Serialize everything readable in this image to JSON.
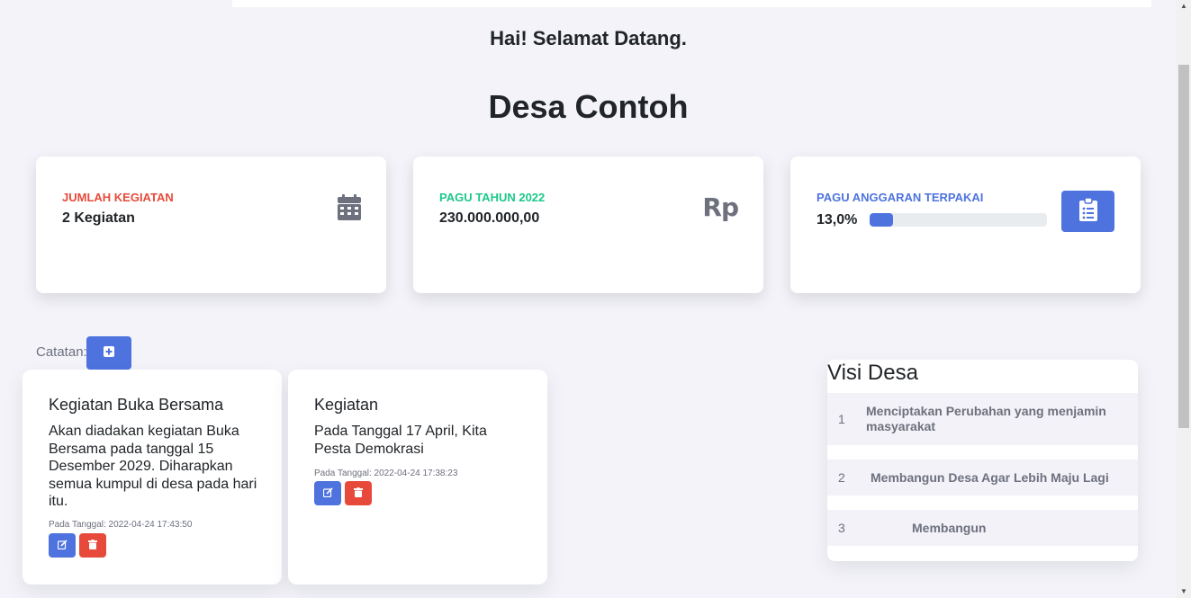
{
  "header": {
    "greeting": "Hai! Selamat Datang.",
    "village_name": "Desa Contoh"
  },
  "stats": [
    {
      "label": "JUMLAH KEGIATAN",
      "value": "2 Kegiatan",
      "color": "#e74a3b",
      "icon": "calendar-icon"
    },
    {
      "label": "PAGU TAHUN 2022",
      "value": "230.000.000,00",
      "color": "#1cc88a",
      "icon": "rupiah-icon",
      "icon_text": "Rp"
    },
    {
      "label": "PAGU ANGGARAN TERPAKAI",
      "value": "13,0%",
      "progress": 0.13,
      "color": "#4e73df",
      "icon": "clipboard-list-icon"
    }
  ],
  "notes": {
    "label": "Catatan:",
    "items": [
      {
        "title": "Kegiatan Buka Bersama",
        "body": "Akan diadakan kegiatan Buka Bersama pada tanggal 15 Desember 2029. Diharapkan semua kumpul di desa pada hari itu.",
        "date": "Pada Tanggal: 2022-04-24 17:43:50"
      },
      {
        "title": "Kegiatan",
        "body": "Pada Tanggal 17 April, Kita Pesta Demokrasi",
        "date": "Pada Tanggal: 2022-04-24 17:38:23"
      }
    ]
  },
  "visi": {
    "title": "Visi Desa",
    "items": [
      {
        "num": "1",
        "text": "Menciptakan Perubahan yang menjamin masyarakat"
      },
      {
        "num": "2",
        "text": "Membangun Desa Agar Lebih Maju Lagi"
      },
      {
        "num": "3",
        "text": "Membangun"
      }
    ]
  },
  "colors": {
    "primary": "#4e73df",
    "danger": "#e74a3b",
    "success": "#1cc88a",
    "muted": "#6e707e"
  }
}
